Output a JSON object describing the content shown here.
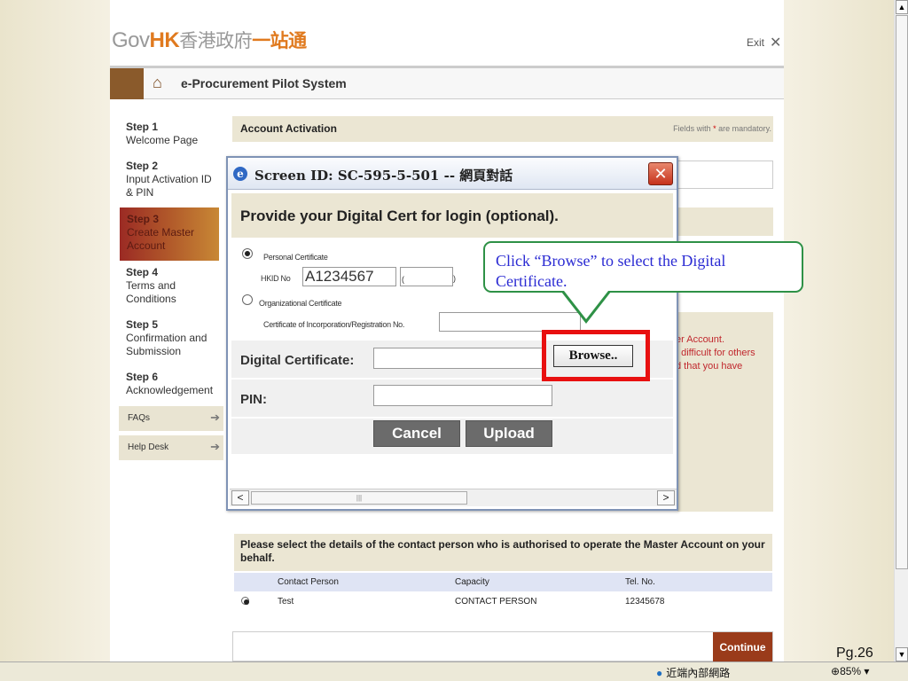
{
  "header": {
    "logo_gov": "Gov",
    "logo_hk": "HK",
    "logo_cn": "香港政府",
    "logo_cn2": "一站通",
    "exit_label": "Exit",
    "close_glyph": "✕"
  },
  "system_title": "e-Procurement Pilot System",
  "steps": [
    {
      "step": "Step 1",
      "label": "Welcome Page"
    },
    {
      "step": "Step 2",
      "label": "Input Activation ID & PIN"
    },
    {
      "step": "Step 3",
      "label": "Create Master Account"
    },
    {
      "step": "Step 4",
      "label": "Terms and Conditions"
    },
    {
      "step": "Step 5",
      "label": "Confirmation and Submission"
    },
    {
      "step": "Step 6",
      "label": "Acknowledgement"
    }
  ],
  "side_buttons": {
    "faqs": "FAQs",
    "help": "Help Desk"
  },
  "account": {
    "heading": "Account Activation",
    "mandatory_pre": "Fields with",
    "mandatory_star": "*",
    "mandatory_post": "are mandatory."
  },
  "background_red_text": [
    "er Account.",
    "t difficult for others",
    "d that you have"
  ],
  "dialog": {
    "title": "Screen ID: SC-595-5-501 -- 網頁對話",
    "heading": "Provide your Digital Cert for login (optional).",
    "personal_cert": "Personal Certificate",
    "hkid_label": "HKID No",
    "hkid_value": "A1234567",
    "hkid_open": "(",
    "hkid_close": ")",
    "org_cert": "Organizational Certificate",
    "org_reg_label": "Certificate of Incorporation/Registration No.",
    "digital_cert_label": "Digital Certificate:",
    "browse_label": "Browse..",
    "pin_label": "PIN:",
    "cancel_label": "Cancel",
    "upload_label": "Upload",
    "scroll_grip": "|||"
  },
  "callout": {
    "text": "Click “Browse” to select the Digital Certificate."
  },
  "contact": {
    "heading": "Please select the details of the contact person who is authorised to operate the Master Account on your behalf.",
    "columns": [
      "Contact Person",
      "Capacity",
      "Tel. No."
    ],
    "rows": [
      {
        "person": "Test",
        "capacity": "CONTACT PERSON",
        "tel": "12345678"
      }
    ]
  },
  "continue_label": "Continue",
  "page_number": "Pg.26",
  "statusbar": {
    "zone": "近端內部網路",
    "zoom": "85%"
  },
  "colors": {
    "brand_orange": "#e07a1f",
    "callout_green": "#2e9146",
    "highlight_red": "#e81010",
    "callout_text": "#2b2bd3"
  }
}
